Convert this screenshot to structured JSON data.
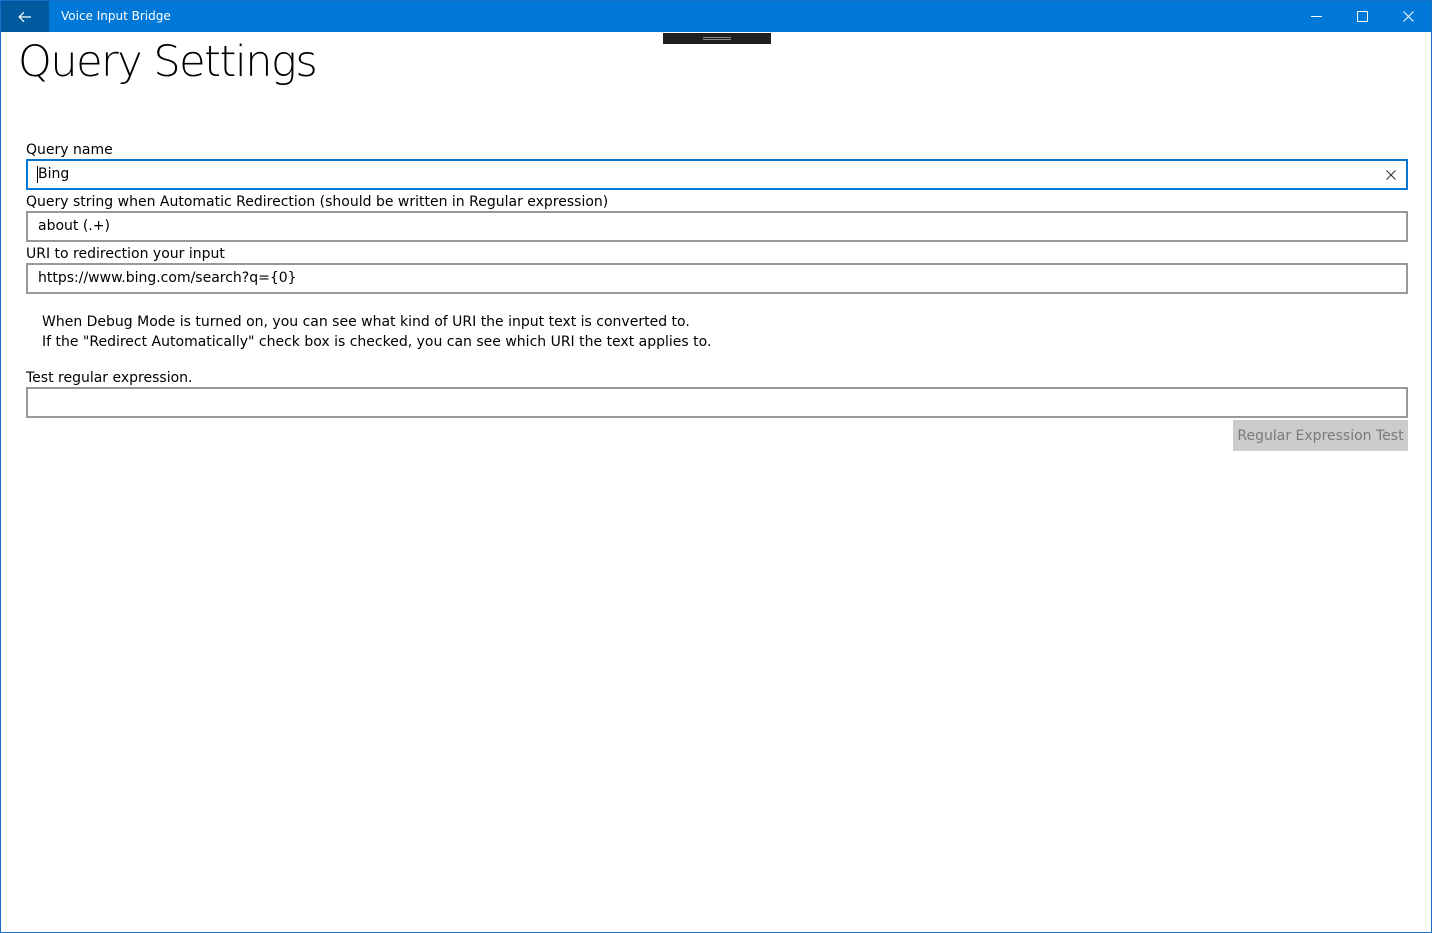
{
  "window": {
    "title": "Voice Input Bridge",
    "accent": "#0078d7"
  },
  "icons": {
    "back": "arrow-left-icon",
    "minimize": "minimize-icon",
    "maximize": "maximize-icon",
    "close": "close-icon",
    "clear": "clear-x-icon"
  },
  "page": {
    "title": "Query Settings"
  },
  "form": {
    "query_name": {
      "label": "Query name",
      "value": "Bing"
    },
    "query_string": {
      "label": "Query string when Automatic Redirection (should be written in Regular expression)",
      "value": "about (.+)"
    },
    "uri": {
      "label": "URI to redirection your input",
      "value": "https://www.bing.com/search?q={0}"
    },
    "info": {
      "line1": "When Debug Mode is turned on, you can see what kind of URI the input text is converted to.",
      "line2": "If the \"Redirect Automatically\" check box is checked, you can see which URI the text applies to."
    },
    "test": {
      "label": "Test regular expression.",
      "value": "",
      "button_label": "Regular Expression Test"
    }
  }
}
